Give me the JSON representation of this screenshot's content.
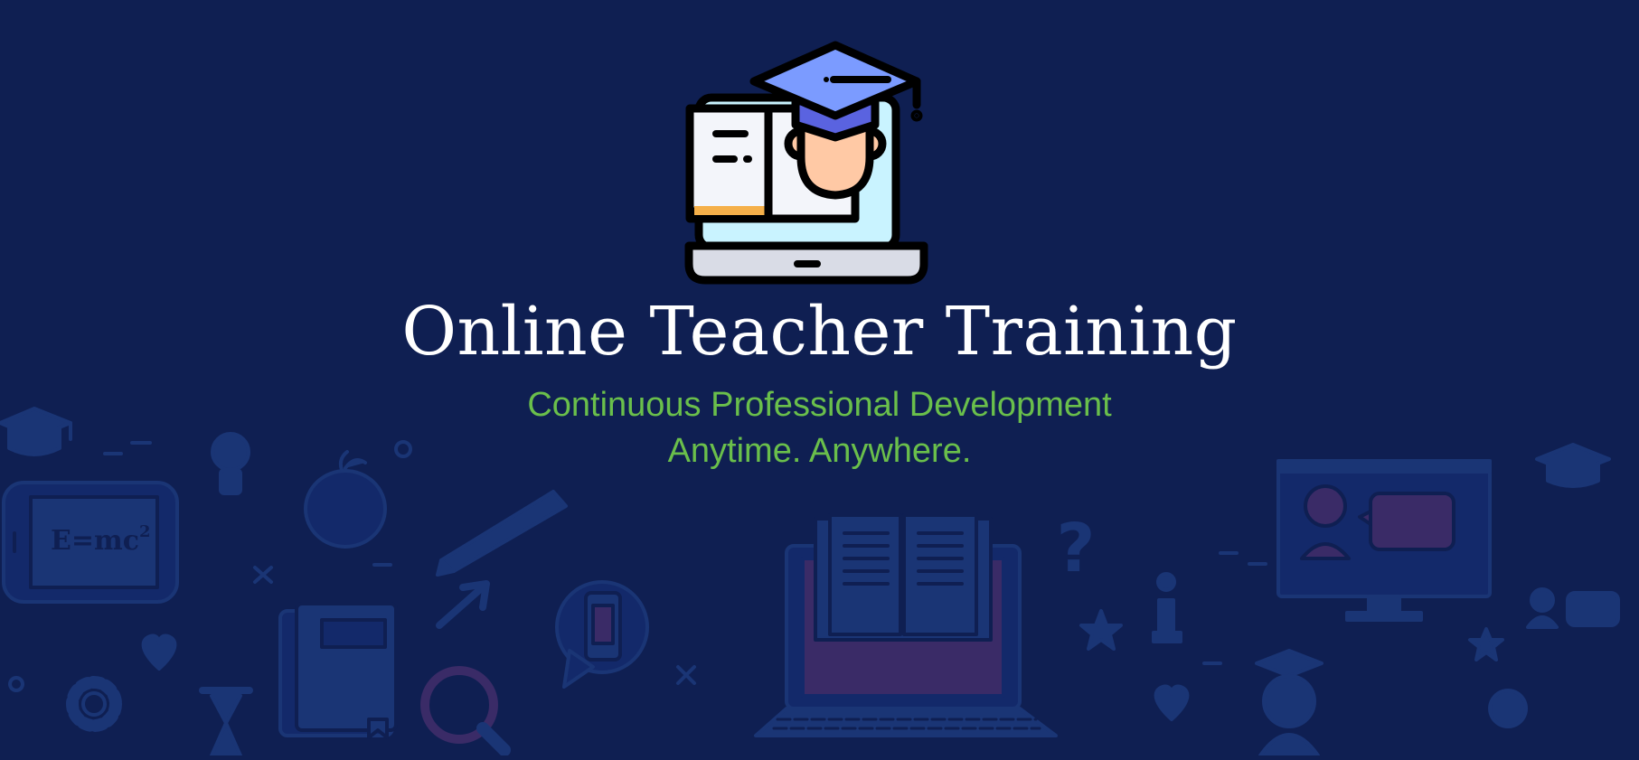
{
  "hero": {
    "title": "Online Teacher Training",
    "subtitle_line1": "Continuous Professional Development",
    "subtitle_line2": "Anytime. Anywhere."
  },
  "background": {
    "equation": "E=mc",
    "equation_superscript": "2",
    "question_mark": "?",
    "info_glyph": "i",
    "icons": [
      "graduation-cap-icon",
      "lightbulb-icon",
      "apple-icon",
      "tablet-icon",
      "pen-icon",
      "book-icon",
      "cursor-arrow-icon",
      "phone-chat-icon",
      "magnifier-icon",
      "gear-icon",
      "hourglass-icon",
      "heart-icon",
      "laptop-book-icon",
      "question-icon",
      "info-icon",
      "star-icon",
      "monitor-chat-icon",
      "student-icon",
      "user-chat-icon"
    ]
  },
  "colors": {
    "background": "#0f1f52",
    "title": "#ffffff",
    "subtitle": "#6abf4b",
    "cap_blue": "#7b9bff",
    "cap_band": "#5a63e0",
    "skin": "#ffc9a5",
    "screen": "#c9f3ff",
    "book_edge": "#f5b04a"
  }
}
